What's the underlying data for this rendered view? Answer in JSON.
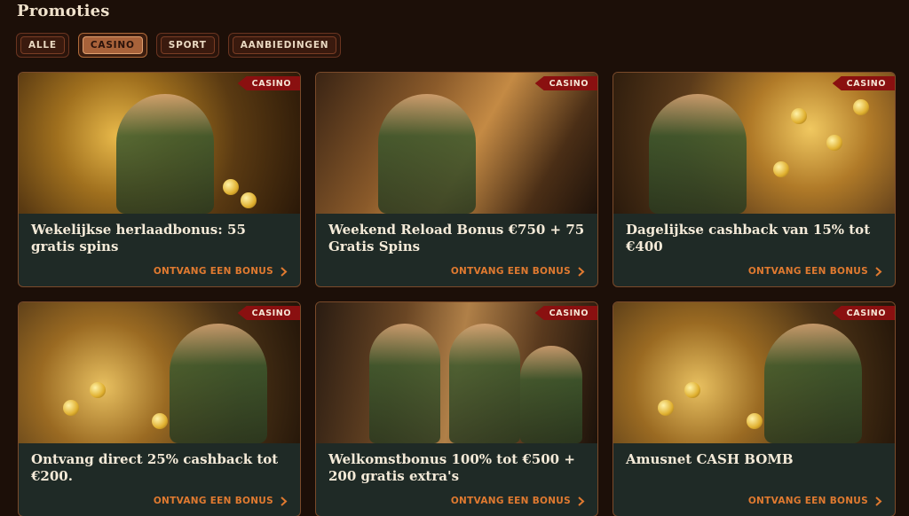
{
  "page": {
    "title": "Promoties"
  },
  "filters": [
    {
      "label": "ALLE",
      "active": false
    },
    {
      "label": "CASINO",
      "active": true
    },
    {
      "label": "SPORT",
      "active": false
    },
    {
      "label": "AANBIEDINGEN",
      "active": false
    }
  ],
  "promotions": [
    {
      "badge": "CASINO",
      "title": "Wekelijkse herlaadbonus: 55 gratis spins",
      "cta": "ONTVANG EEN BONUS"
    },
    {
      "badge": "CASINO",
      "title": "Weekend Reload Bonus €750 + 75 Gratis Spins",
      "cta": "ONTVANG EEN BONUS"
    },
    {
      "badge": "CASINO",
      "title": "Dagelijkse cashback van 15% tot €400",
      "cta": "ONTVANG EEN BONUS"
    },
    {
      "badge": "CASINO",
      "title": "Ontvang direct 25% cashback tot €200.",
      "cta": "ONTVANG EEN BONUS"
    },
    {
      "badge": "CASINO",
      "title": "Welkomstbonus 100% tot €500 + 200 gratis extra's",
      "cta": "ONTVANG EEN BONUS"
    },
    {
      "badge": "CASINO",
      "title": "Amusnet CASH BOMB",
      "cta": "ONTVANG EEN BONUS"
    }
  ],
  "colors": {
    "accent": "#e07a30",
    "badge": "#8a1010",
    "card_body": "#1f2a26",
    "page_bg": "#1c0f08"
  }
}
